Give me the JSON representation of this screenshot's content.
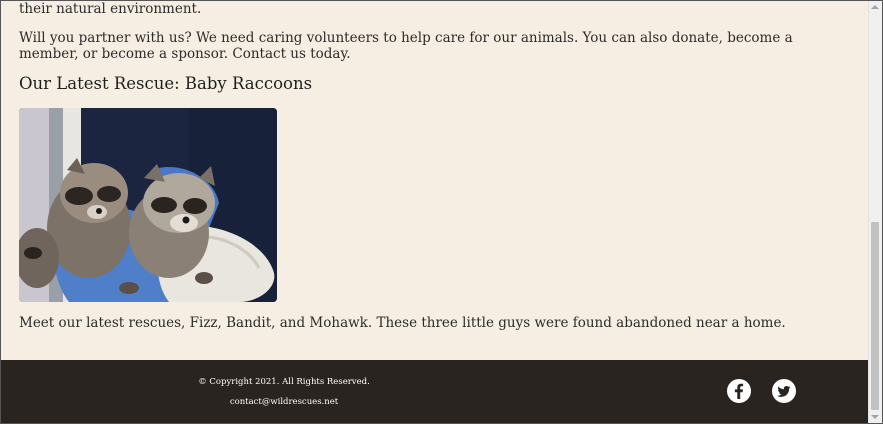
{
  "article": {
    "intro_tail": "their natural environment.",
    "partner_text": "Will you partner with us? We need caring volunteers to help care for our animals. You can also donate, become a member, or become a sponsor. Contact us today.",
    "rescue_heading": "Our Latest Rescue: Baby Raccoons",
    "photo_alt": "Baby raccoons",
    "caption": "Meet our latest rescues, Fizz, Bandit, and Mohawk. These three little guys were found abandoned near a home."
  },
  "footer": {
    "copyright": "© Copyright 2021. All Rights Reserved.",
    "contact_email": "contact@wildrescues.net",
    "social": [
      {
        "icon": "facebook-icon"
      },
      {
        "icon": "twitter-icon"
      }
    ]
  },
  "colors": {
    "page_background": "#f6eee2",
    "footer_background": "#2a2421",
    "text": "#2b2b2b",
    "footer_text": "#ffffff"
  }
}
